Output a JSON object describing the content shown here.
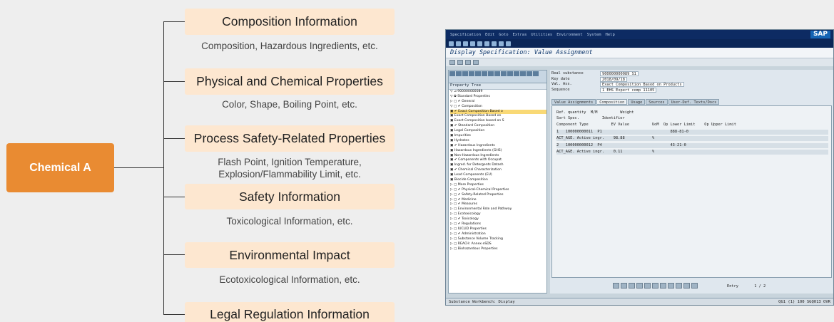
{
  "root": {
    "label": "Chemical A"
  },
  "categories": [
    {
      "title": "Composition Information",
      "desc": "Composition, Hazardous Ingredients, etc."
    },
    {
      "title": "Physical and Chemical Properties",
      "desc": "Color, Shape, Boiling Point, etc."
    },
    {
      "title": "Process Safety-Related Properties",
      "desc": "Flash Point, Ignition Temperature,\nExplosion/Flammability Limit, etc."
    },
    {
      "title": "Safety Information",
      "desc": "Toxicological Information, etc."
    },
    {
      "title": "Environmental Impact",
      "desc": "Ecotoxicological Information, etc."
    },
    {
      "title": "Legal Regulation Information",
      "desc": ""
    }
  ],
  "colors": {
    "root": "#e98b32",
    "category_box": "#fde7d0",
    "connector": "#333333"
  },
  "sap": {
    "logo": "SAP",
    "menu": [
      "Specification",
      "Edit",
      "Goto",
      "Extras",
      "Utilities",
      "Environment",
      "System",
      "Help"
    ],
    "screen_title": "Display Specification: Value Assignment",
    "tree_header": "Property Tree",
    "tree": [
      {
        "text": "▽ ⊿ 900000000089",
        "sel": false
      },
      {
        "text": "   ▽ ✿ Standard Properties",
        "sel": false
      },
      {
        "text": "      ▷ ▢ ✔ General",
        "sel": false
      },
      {
        "text": "      ▽ ▢ ✔ Composition",
        "sel": false
      },
      {
        "text": "          ▣ ✔ Exact Composition Based o",
        "sel": true
      },
      {
        "text": "          ▣ Exact Composition Based on",
        "sel": false
      },
      {
        "text": "          ▣ Exact Composition based on S",
        "sel": false
      },
      {
        "text": "          ▣ ✔ Standard Composition",
        "sel": false
      },
      {
        "text": "          ▣ Legal Composition",
        "sel": false
      },
      {
        "text": "          ▣ Impurities",
        "sel": false
      },
      {
        "text": "          ▣ Hydrates",
        "sel": false
      },
      {
        "text": "          ▣ ✔ Hazardous Ingredients",
        "sel": false
      },
      {
        "text": "          ▣ Hazardous Ingredients (GHS)",
        "sel": false
      },
      {
        "text": "          ▣ Non-Hazardous Ingredients",
        "sel": false
      },
      {
        "text": "          ▣ ✔ Components with Occupat.",
        "sel": false
      },
      {
        "text": "          ▣ Ingred. for Detergents Datash",
        "sel": false
      },
      {
        "text": "          ▣ ✔ Chemical Characterization",
        "sel": false
      },
      {
        "text": "          ▣ Lead Components (EU)",
        "sel": false
      },
      {
        "text": "          ▣ Biocide Composition",
        "sel": false
      },
      {
        "text": "        ▷ ▢ More Properties",
        "sel": false
      },
      {
        "text": "      ▷ ▢ ✔ Physical-Chemical Properties",
        "sel": false
      },
      {
        "text": "      ▷ ▢ ✔ Safety-Related Properties",
        "sel": false
      },
      {
        "text": "      ▷ ▢ ✔ Medicine",
        "sel": false
      },
      {
        "text": "      ▷ ▢ ✔ Measures",
        "sel": false
      },
      {
        "text": "      ▷ ▢ Environmental Fate and Pathway",
        "sel": false
      },
      {
        "text": "      ▷ ▢ Ecotoxicology",
        "sel": false
      },
      {
        "text": "      ▷ ▢ ✔ Toxicology",
        "sel": false
      },
      {
        "text": "      ▷ ▢ ✔ Regulations",
        "sel": false
      },
      {
        "text": "      ▷ ▢ IUCLID Properties",
        "sel": false
      },
      {
        "text": "      ▷ ▢ ✔ Administration",
        "sel": false
      },
      {
        "text": "      ▷ ▢ Substance Volume Tracking",
        "sel": false
      },
      {
        "text": "      ▷ ▢ REACH: Annex eSDS",
        "sel": false
      },
      {
        "text": "      ▷ ▢ Biohazardous Properties",
        "sel": false
      }
    ],
    "header_fields": [
      {
        "label": "Real substance",
        "value": "900000000089  S1"
      },
      {
        "label": "Key date",
        "value": "2018/09/18"
      },
      {
        "label": "Val. Ass.",
        "value": "Exact Composition Based on Products"
      },
      {
        "label": "Sequence",
        "value": "1       EHS Expert      comp 11105"
      }
    ],
    "tabs": [
      "Value Assignments",
      "Composition",
      "Usage",
      "Sources",
      "User-Def. Texts/Docs"
    ],
    "comp_rows": [
      "Ref. quantity  M/M          Weight",
      "Sort Spec.          Identifier",
      "Component Type          EV Value          UoM  Op Lower Limit    Op Upper Limit",
      "1   100000000011  P1                              888-81-0",
      "ACT_AGE. Active ingr.    98.88            %",
      "2   100000000012  P4                              43-21-0",
      "ACT_AGE. Active ingr.    0.11             %"
    ],
    "entry_label": "Entry       1 / 2",
    "status_left": "Substance Workbench: Display",
    "status_right": "QG1 (1) 100  SGQ013  OVR"
  }
}
